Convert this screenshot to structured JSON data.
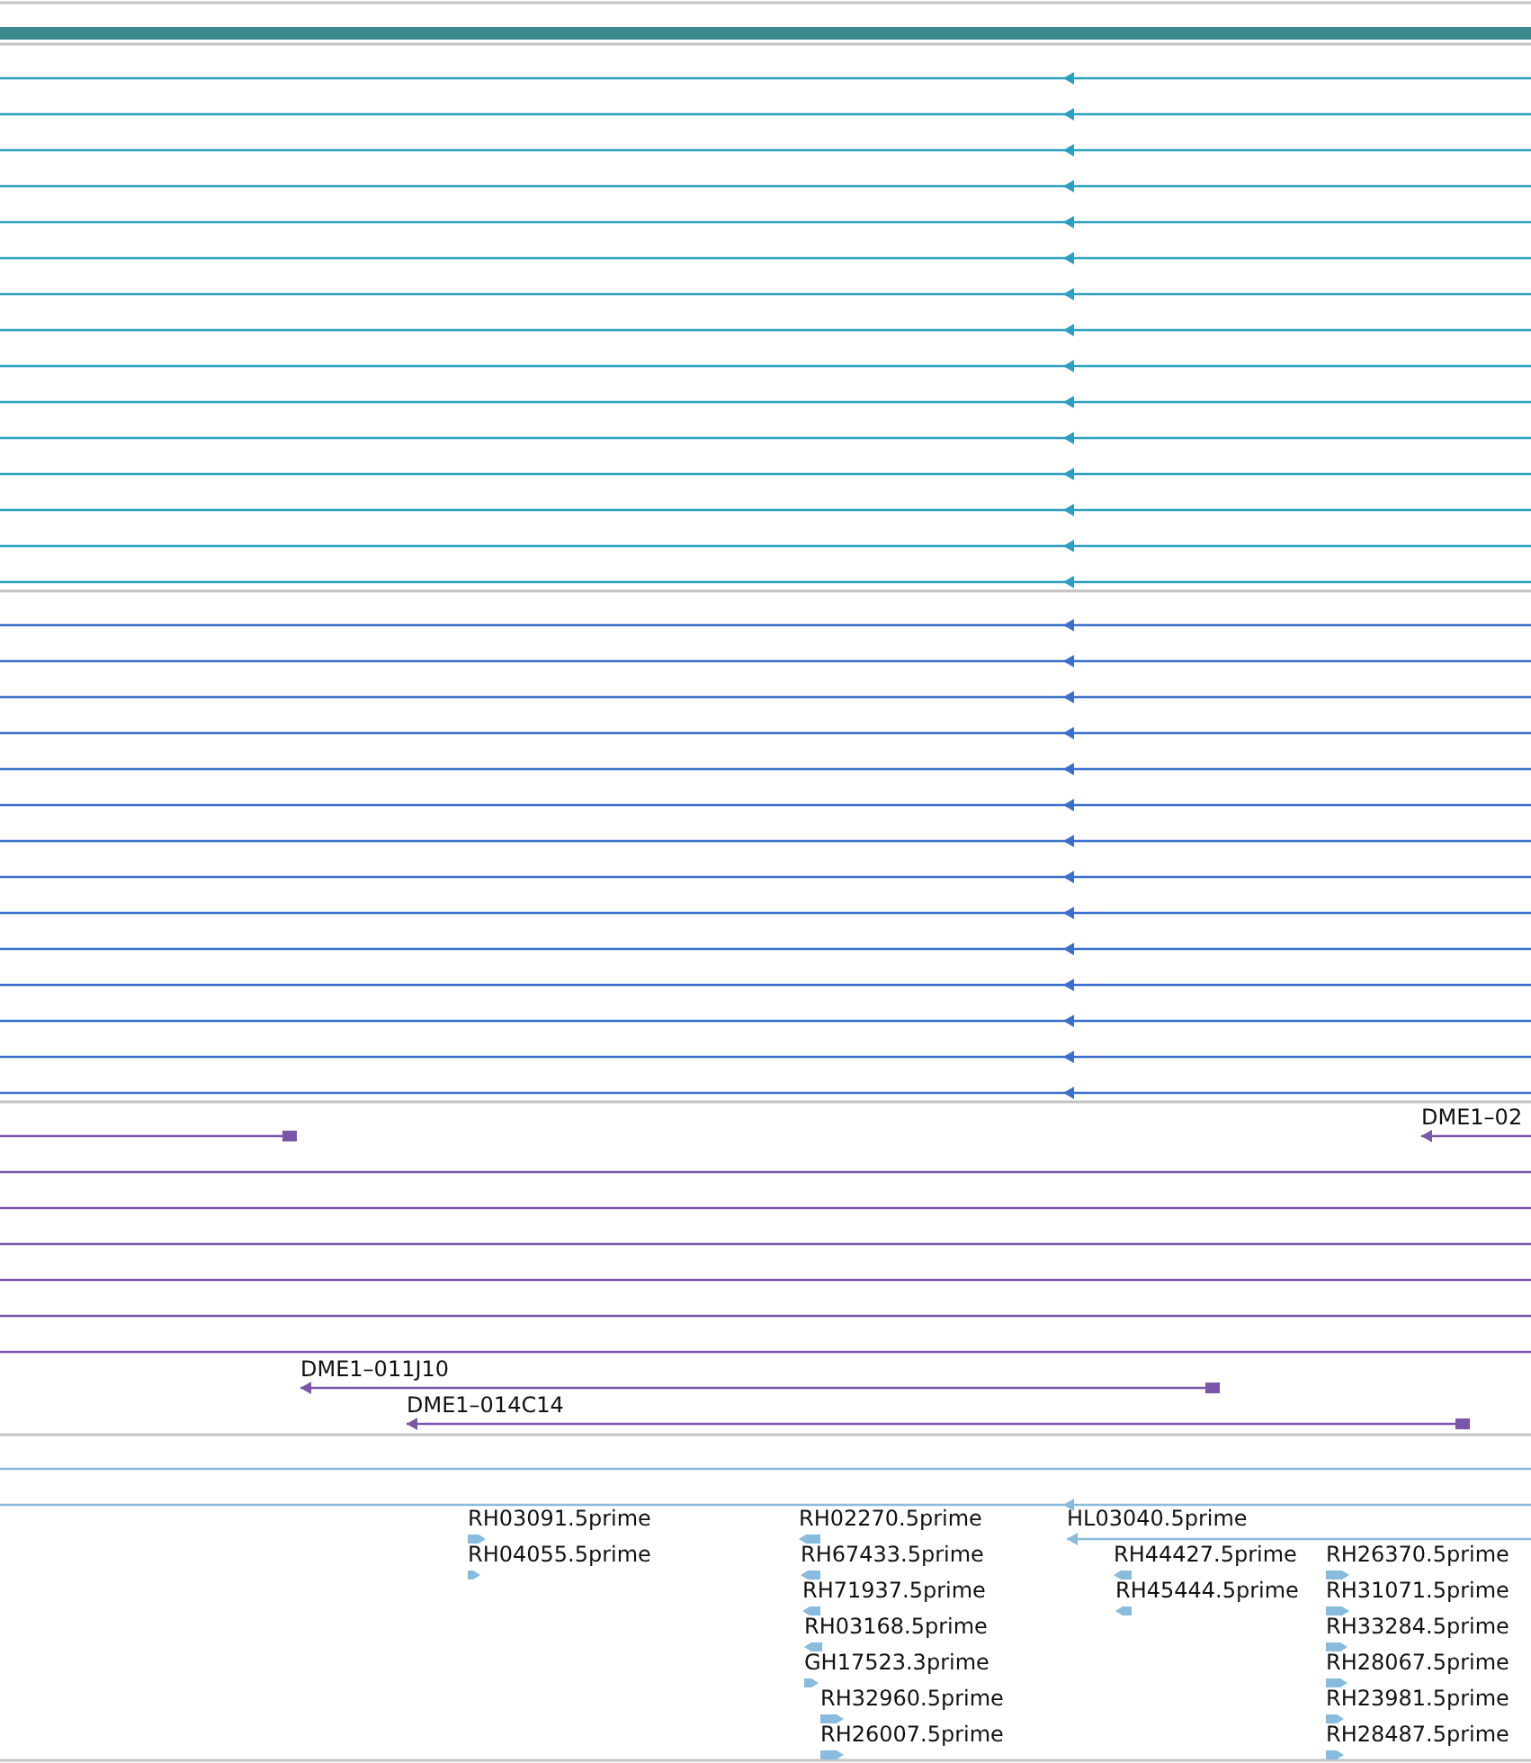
{
  "tracks": [
    {
      "color": "#2a9fbf",
      "features": [
        {
          "kind": "transcript",
          "reverse": true
        },
        {
          "kind": "transcript",
          "reverse": true
        },
        {
          "kind": "transcript",
          "reverse": true
        },
        {
          "kind": "transcript",
          "reverse": true
        },
        {
          "kind": "transcript",
          "reverse": true
        },
        {
          "kind": "transcript",
          "reverse": true
        },
        {
          "kind": "transcript",
          "reverse": true
        },
        {
          "kind": "transcript",
          "reverse": true
        },
        {
          "kind": "transcript",
          "reverse": true
        },
        {
          "kind": "transcript",
          "reverse": true
        },
        {
          "kind": "transcript",
          "reverse": true
        },
        {
          "kind": "transcript",
          "reverse": true
        },
        {
          "kind": "transcript",
          "reverse": true
        },
        {
          "kind": "transcript",
          "reverse": true
        },
        {
          "kind": "transcript",
          "reverse": true
        }
      ]
    },
    {
      "color": "#3a6fcc",
      "features": [
        {
          "kind": "transcript",
          "reverse": true
        },
        {
          "kind": "transcript",
          "reverse": true
        },
        {
          "kind": "transcript",
          "reverse": true
        },
        {
          "kind": "transcript",
          "reverse": true
        },
        {
          "kind": "transcript",
          "reverse": true
        },
        {
          "kind": "transcript",
          "reverse": true
        },
        {
          "kind": "transcript",
          "reverse": true
        },
        {
          "kind": "transcript",
          "reverse": true
        },
        {
          "kind": "transcript",
          "reverse": true
        },
        {
          "kind": "transcript",
          "reverse": true
        },
        {
          "kind": "transcript",
          "reverse": true
        },
        {
          "kind": "transcript",
          "reverse": true
        },
        {
          "kind": "transcript",
          "reverse": true
        },
        {
          "kind": "transcript",
          "reverse": true
        }
      ]
    },
    {
      "color": "#7a55aa",
      "features": [
        {
          "kind": "clone",
          "reverse": true
        },
        {
          "kind": "clone",
          "label": "DME1–02",
          "reverse": true
        },
        {
          "kind": "span"
        },
        {
          "kind": "span"
        },
        {
          "kind": "span"
        },
        {
          "kind": "span"
        },
        {
          "kind": "span"
        },
        {
          "kind": "span"
        },
        {
          "kind": "clone",
          "label": "DME1–011J10",
          "reverse": true
        },
        {
          "kind": "clone",
          "label": "DME1–014C14",
          "reverse": true
        }
      ]
    },
    {
      "color": "#88bbdd",
      "features": [
        {
          "kind": "span"
        },
        {
          "kind": "transcript",
          "reverse": true
        },
        {
          "kind": "est",
          "label": "RH03091.5prime",
          "reverse": false
        },
        {
          "kind": "est",
          "label": "RH02270.5prime",
          "reverse": true
        },
        {
          "kind": "transcript",
          "label": "HL03040.5prime",
          "reverse": true
        },
        {
          "kind": "est",
          "label": "RH04055.5prime",
          "reverse": false
        },
        {
          "kind": "est",
          "label": "RH67433.5prime",
          "reverse": true
        },
        {
          "kind": "est",
          "label": "RH44427.5prime",
          "reverse": true
        },
        {
          "kind": "est",
          "label": "RH26370.5prime",
          "reverse": false
        },
        {
          "kind": "est",
          "label": "RH71937.5prime",
          "reverse": true
        },
        {
          "kind": "est",
          "label": "RH45444.5prime",
          "reverse": true
        },
        {
          "kind": "est",
          "label": "RH31071.5prime",
          "reverse": false
        },
        {
          "kind": "est",
          "label": "RH03168.5prime",
          "reverse": true
        },
        {
          "kind": "est",
          "label": "RH33284.5prime",
          "reverse": false
        },
        {
          "kind": "est",
          "label": "GH17523.3prime",
          "reverse": false
        },
        {
          "kind": "est",
          "label": "RH28067.5prime",
          "reverse": false
        },
        {
          "kind": "est",
          "label": "RH32960.5prime",
          "reverse": false
        },
        {
          "kind": "est",
          "label": "RH23981.5prime",
          "reverse": false
        },
        {
          "kind": "est",
          "label": "RH26007.5prime",
          "reverse": false
        },
        {
          "kind": "est",
          "label": "RH28487.5prime",
          "reverse": false
        }
      ]
    }
  ]
}
